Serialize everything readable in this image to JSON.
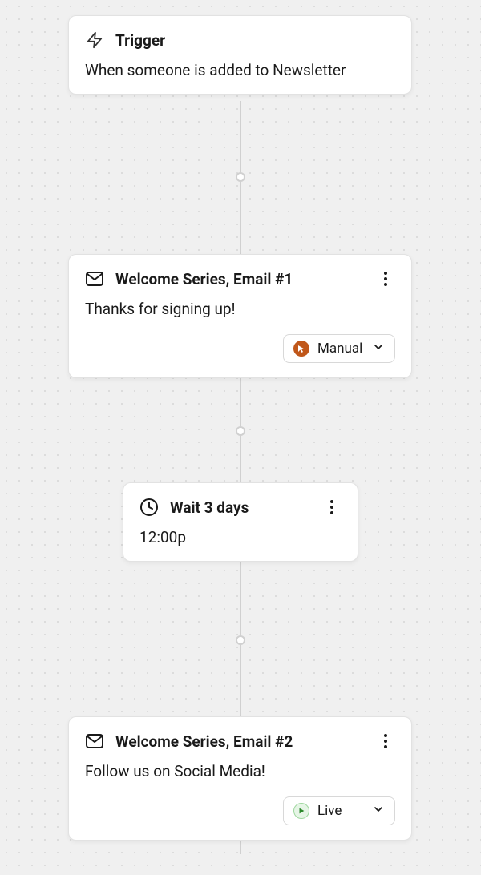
{
  "flow": {
    "trigger": {
      "title": "Trigger",
      "description": "When someone is added to Newsletter"
    },
    "nodes": [
      {
        "type": "email",
        "title": "Welcome Series, Email #1",
        "description": "Thanks for signing up!",
        "status": "Manual"
      },
      {
        "type": "wait",
        "title": "Wait 3 days",
        "description": "12:00p"
      },
      {
        "type": "email",
        "title": "Welcome Series, Email #2",
        "description": "Follow us on Social Media!",
        "status": "Live"
      }
    ]
  }
}
